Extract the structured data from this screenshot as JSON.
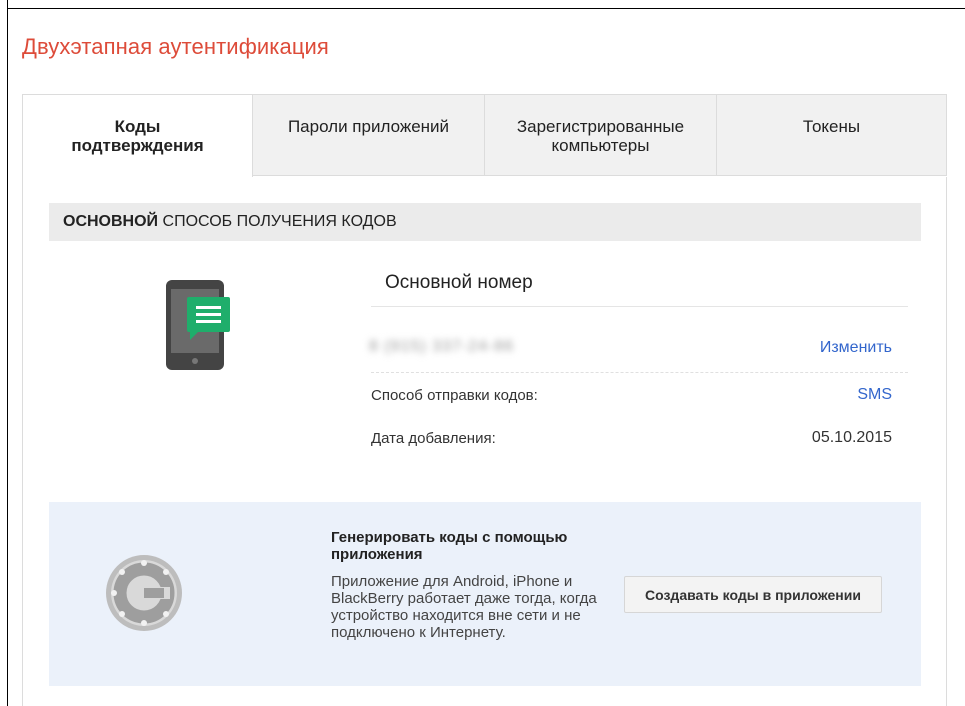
{
  "page": {
    "title": "Двухэтапная аутентификация"
  },
  "tabs": [
    {
      "label": "Коды подтверждения",
      "active": true
    },
    {
      "label": "Пароли приложений",
      "active": false
    },
    {
      "label": "Зарегистрированные компьютеры",
      "active": false
    },
    {
      "label": "Токены",
      "active": false
    }
  ],
  "section": {
    "heading_bold": "ОСНОВНОЙ",
    "heading_rest": "СПОСОБ ПОЛУЧЕНИЯ КОДОВ"
  },
  "primary": {
    "title": "Основной номер",
    "phone_number": "8 (915) 337-24-86",
    "change_link": "Изменить",
    "method_label": "Способ отправки кодов:",
    "method_value": "SMS",
    "date_label": "Дата добавления:",
    "date_value": "05.10.2015"
  },
  "app": {
    "title": "Генерировать коды с помощью приложения",
    "description": "Приложение для Android, iPhone и BlackBerry работает даже тогда, когда устройство находится вне сети и не подключено к Интернету.",
    "button_label": "Создавать коды в приложении"
  },
  "icons": {
    "phone": "phone-sms-icon",
    "authenticator": "google-authenticator-icon"
  },
  "colors": {
    "title": "#dd4b39",
    "link": "#3366cc",
    "app_box": "#ebf1fa",
    "sms_bubble": "#1fae6b"
  }
}
